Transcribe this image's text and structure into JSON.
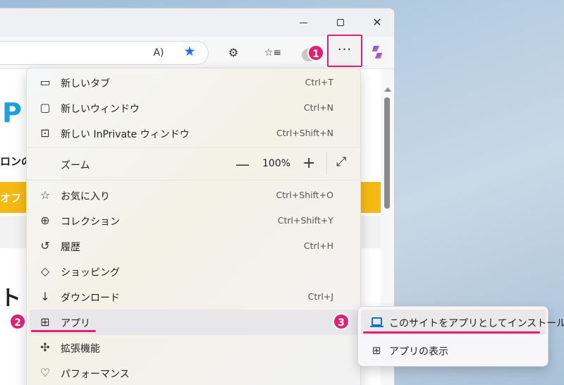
{
  "window": {
    "min_glyph": "",
    "max_glyph": "",
    "close_glyph": "✕"
  },
  "toolbar": {
    "read_aloud_glyph": "A)",
    "favorite_glyph": "★",
    "extensions_glyph": "⚙",
    "favorites_list_glyph": "☆≡",
    "more_label": "···"
  },
  "page": {
    "logo_text": "P",
    "heading1": "ロンの",
    "band_text": "オフ",
    "heading2": "ト"
  },
  "menu": {
    "items": [
      {
        "label": "新しいタブ",
        "shortcut": "Ctrl+T",
        "icon": "new-tab-icon",
        "glyph": "▭"
      },
      {
        "label": "新しいウィンドウ",
        "shortcut": "Ctrl+N",
        "icon": "new-window-icon",
        "glyph": "▢"
      },
      {
        "label": "新しい InPrivate ウィンドウ",
        "shortcut": "Ctrl+Shift+N",
        "icon": "inprivate-icon",
        "glyph": "⊡"
      },
      {
        "label": "お気に入り",
        "shortcut": "Ctrl+Shift+O",
        "icon": "favorites-icon",
        "glyph": "☆"
      },
      {
        "label": "コレクション",
        "shortcut": "Ctrl+Shift+Y",
        "icon": "collections-icon",
        "glyph": "⊕"
      },
      {
        "label": "履歴",
        "shortcut": "Ctrl+H",
        "icon": "history-icon",
        "glyph": "↺"
      },
      {
        "label": "ショッピング",
        "shortcut": "",
        "icon": "shopping-tag-icon",
        "glyph": "◇"
      },
      {
        "label": "ダウンロード",
        "shortcut": "Ctrl+J",
        "icon": "download-icon",
        "glyph": "↓"
      },
      {
        "label": "アプリ",
        "shortcut": "",
        "icon": "apps-icon",
        "glyph": "⊞"
      },
      {
        "label": "拡張機能",
        "shortcut": "",
        "icon": "extensions-icon",
        "glyph": "✣"
      },
      {
        "label": "パフォーマンス",
        "shortcut": "",
        "icon": "performance-icon",
        "glyph": "♡"
      }
    ],
    "zoom": {
      "label": "ズーム",
      "value": "100%",
      "minus": "—",
      "plus": "+",
      "fullscreen_glyph": "⤢"
    }
  },
  "submenu": {
    "install_label": "このサイトをアプリとしてインストール",
    "show_apps_label": "アプリの表示",
    "show_apps_glyph": "⊞"
  },
  "badges": [
    "1",
    "2",
    "3"
  ],
  "colors": {
    "highlight": "#e2216e",
    "accent_blue": "#0a74c9",
    "band": "#f6b914"
  }
}
